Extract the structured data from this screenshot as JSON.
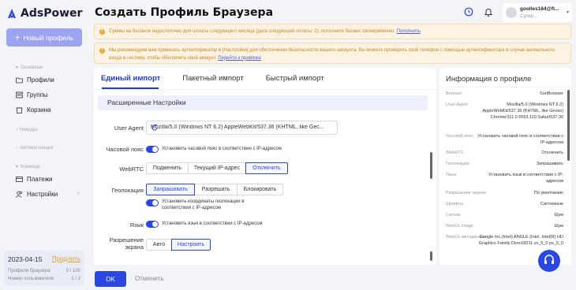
{
  "app": {
    "name": "AdsPower"
  },
  "sidebar": {
    "new_profile_label": "Новый профиль",
    "sections": {
      "basic": "Основные",
      "tasks": "Никсдки",
      "automation": "Автоматизация",
      "team": "Команда"
    },
    "items": {
      "profiles": "Профили",
      "groups": "Группы",
      "trash": "Корзина",
      "payments": "Платежи",
      "settings": "Настройки"
    },
    "bottom": {
      "date": "2023-04-15",
      "extend": "Продлить",
      "browser_profiles_label": "Профили браузера",
      "browser_profiles_value": "0 / 100",
      "user_number_label": "Номер пользователя",
      "user_number_value": "1 / 2"
    }
  },
  "header": {
    "title": "Создать Профиль Браузера",
    "user_name": "goolles164@fl...",
    "user_role": "Супер..."
  },
  "banners": {
    "balance_text": "Суммы на балансе недостаточно для оплаты следующего месяца (дата следующей оплаты: 2), пополните баланс своевременно. ",
    "balance_link": "Пополнить",
    "auth_text": "Мы рекомендуем вам привязать аутентификатор в [Настройки] для обеспечения безопасности вашего аккаунта. Вы можете проверить свой телефон с помощью аутентификатора в случае аномального входа в систему, чтобы обеспечить свой аккаунт. ",
    "auth_link": "Перейти к привязке"
  },
  "tabs": [
    "Единый импорт",
    "Пакетный импорт",
    "Быстрый импорт"
  ],
  "form": {
    "advanced_settings": "Расширенные Настройки",
    "user_agent_label": "User Agent",
    "user_agent_value": "Mozilla/5.0 (Windows NT 6.2) AppleWebKit/537.36 (KHTML, like Gec...",
    "timezone_label": "Часовой пояс",
    "timezone_toggle": "Установить часовой пояс в соответствии с IP-адресом",
    "webrtc_label": "WebRTC",
    "webrtc_options": [
      "Подменить",
      "Текущий IP-адрес",
      "Отключить"
    ],
    "geo_label": "Геолокация",
    "geo_options": [
      "Запрашивать",
      "Разрешать",
      "Блокировать"
    ],
    "geo_toggle_line1": "Установить координаты геолокации в",
    "geo_toggle_line2": "соответствии с IP-адресом",
    "language_label": "Язык",
    "language_toggle": "Установить язык в соответствии с IP-адресом",
    "resolution_label_1": "Разрешение",
    "resolution_label_2": "экрана",
    "resolution_options": [
      "Авто",
      "Настроить"
    ]
  },
  "info": {
    "title": "Информация о профиле",
    "rows": [
      {
        "k": "Browser",
        "v": "SunBrowser"
      },
      {
        "k": "User-Agent",
        "v": "Mozilla/5.0 (Windows NT 6.2) AppleWebKit/537.36 (KHTML, like Gecko) Chrome/111.0.5563.110 Safari/537.36"
      },
      {
        "k": "Часовой пояс",
        "v": "Установить часовой пояс в соответствии с IP-адресом"
      },
      {
        "k": "WebRTC",
        "v": "Отключить"
      },
      {
        "k": "Геолокация",
        "v": "Запрашивать"
      },
      {
        "k": "Язык",
        "v": "Установить язык в соответствии с IP-адресом"
      },
      {
        "k": "Разрешение экрана",
        "v": "По умолчанию"
      },
      {
        "k": "Шрифты",
        "v": "Системные"
      },
      {
        "k": "Canvas",
        "v": "Шум"
      },
      {
        "k": "WebGL image",
        "v": "Шум"
      },
      {
        "k": "WebGL метаданные",
        "v": "Google Inc.(Intel) ANGLE (Intel, Intel(R) HD Graphics Family Direct3D11 vs_5_0 ps_5_0"
      }
    ]
  },
  "footer": {
    "ok": "OK",
    "cancel": "Отменить"
  },
  "colors": {
    "primary": "#2a47e0",
    "warning": "#f2a33a",
    "extend": "#e0a31e"
  }
}
